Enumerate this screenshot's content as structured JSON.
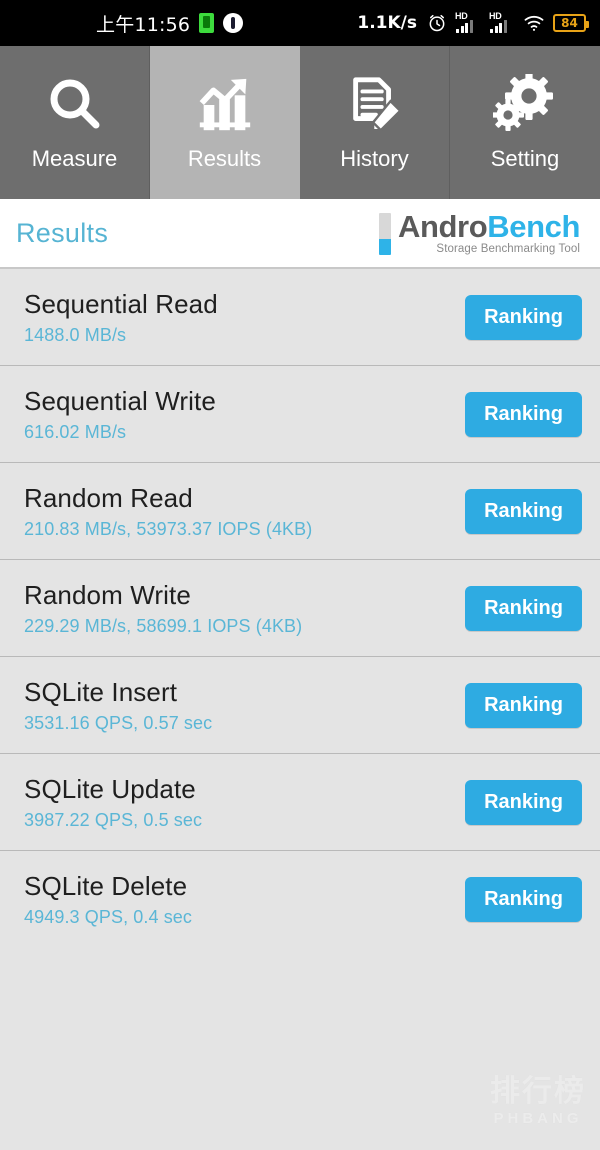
{
  "statusbar": {
    "clock": "上午11:56",
    "battery_saver_icon": "battery-green-icon",
    "vibrate_icon": "vibrate-icon",
    "network_speed": "1.1K/s",
    "alarm_icon": "alarm-clock-icon",
    "signal1_label": "HD",
    "signal2_label": "HD",
    "wifi_icon": "wifi-icon",
    "battery_percent": "84"
  },
  "tabs": [
    {
      "label": "Measure",
      "icon": "magnifier-icon",
      "active": false
    },
    {
      "label": "Results",
      "icon": "bar-chart-arrow-icon",
      "active": true
    },
    {
      "label": "History",
      "icon": "document-pencil-icon",
      "active": false
    },
    {
      "label": "Setting",
      "icon": "gears-icon",
      "active": false
    }
  ],
  "header": {
    "title": "Results",
    "brand_first": "Andro",
    "brand_second": "Bench",
    "brand_subtitle": "Storage Benchmarking Tool"
  },
  "colors": {
    "accent_blue": "#2eabe2",
    "value_blue": "#5ab6d6",
    "title_blue": "#56b4d3",
    "tab_inactive": "#6e6e6e",
    "tab_active": "#b4b4b4",
    "battery_orange": "#e8a317"
  },
  "results": [
    {
      "title": "Sequential Read",
      "value": "1488.0 MB/s",
      "button": "Ranking"
    },
    {
      "title": "Sequential Write",
      "value": "616.02 MB/s",
      "button": "Ranking"
    },
    {
      "title": "Random Read",
      "value": "210.83 MB/s, 53973.37 IOPS (4KB)",
      "button": "Ranking"
    },
    {
      "title": "Random Write",
      "value": "229.29 MB/s, 58699.1 IOPS (4KB)",
      "button": "Ranking"
    },
    {
      "title": "SQLite Insert",
      "value": "3531.16 QPS, 0.57 sec",
      "button": "Ranking"
    },
    {
      "title": "SQLite Update",
      "value": "3987.22 QPS, 0.5 sec",
      "button": "Ranking"
    },
    {
      "title": "SQLite Delete",
      "value": "4949.3 QPS, 0.4 sec",
      "button": "Ranking"
    }
  ],
  "watermark": {
    "chinese": "排行榜",
    "english": "PHBANG"
  }
}
